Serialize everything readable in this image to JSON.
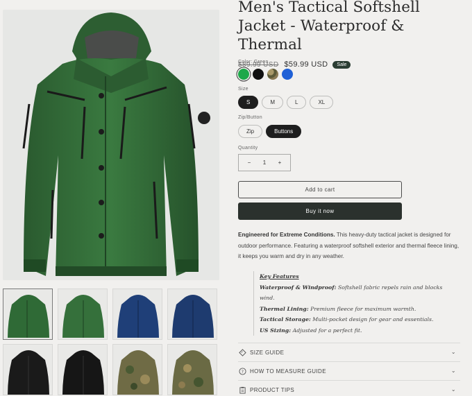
{
  "product": {
    "title": "Men's Tactical Softshell Jacket - Waterproof & Thermal",
    "old_price": "$89.99 USD",
    "new_price": "$59.99 USD",
    "badge": "Sale"
  },
  "color": {
    "label": "Color: Green",
    "swatches": [
      {
        "name": "green",
        "hex": "#1ea84a",
        "selected": true
      },
      {
        "name": "black",
        "hex": "#111111"
      },
      {
        "name": "camo",
        "hex": "#8a7a55"
      },
      {
        "name": "blue",
        "hex": "#1f60d6"
      }
    ]
  },
  "size": {
    "label": "Size",
    "options": [
      "S",
      "M",
      "L",
      "XL"
    ],
    "selected": "S"
  },
  "zip": {
    "label": "Zip/Button",
    "options": [
      "Zip",
      "Buttons"
    ],
    "selected": "Buttons"
  },
  "quantity": {
    "label": "Quantity",
    "minus": "−",
    "value": "1",
    "plus": "+"
  },
  "buttons": {
    "add_to_cart": "Add to cart",
    "buy_now": "Buy it now"
  },
  "description": {
    "lead": "Engineered for Extreme Conditions.",
    "body": " This heavy-duty tactical jacket is designed for outdoor performance. Featuring a waterproof softshell exterior and thermal fleece lining, it keeps you warm and dry in any weather."
  },
  "features": {
    "heading": "Key Features",
    "items": [
      {
        "title": "Waterproof & Windproof:",
        "text": " Softshell fabric repels rain and blocks wind."
      },
      {
        "title": "Thermal Lining:",
        "text": " Premium fleece for maximum warmth."
      },
      {
        "title": "Tactical Storage:",
        "text": " Multi-pocket design for gear and essentials."
      },
      {
        "title": "US Sizing:",
        "text": " Adjusted for a perfect fit."
      }
    ]
  },
  "accordions": [
    {
      "label": "SIZE GUIDE",
      "icon": "ruler-icon"
    },
    {
      "label": "HOW TO MEASURE GUIDE",
      "icon": "question-circle-icon"
    },
    {
      "label": "PRODUCT TIPS",
      "icon": "clipboard-icon"
    }
  ],
  "gallery": {
    "thumbnails": [
      {
        "color": "green",
        "selected": true
      },
      {
        "color": "green"
      },
      {
        "color": "blue"
      },
      {
        "color": "blue"
      },
      {
        "color": "black"
      },
      {
        "color": "black"
      },
      {
        "color": "camo"
      },
      {
        "color": "camo"
      }
    ]
  }
}
